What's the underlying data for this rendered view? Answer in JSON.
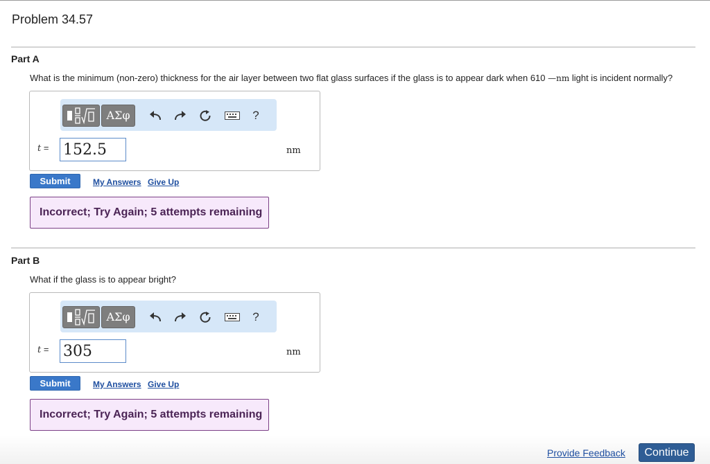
{
  "page_title": "Problem 34.57",
  "colors": {
    "submit_blue": "#3a78c9",
    "feedback_bg": "#f7e9fb",
    "feedback_border": "#7b3f86",
    "toolbar_bg": "#d6e7f8",
    "continue_blue": "#2f5d95"
  },
  "toolbar": {
    "templates_icon": "fraction-sqrt-templates-icon",
    "symbols_label": "ΑΣφ",
    "undo_icon": "undo-arrow-icon",
    "redo_icon": "redo-arrow-icon",
    "reset_icon": "reset-circle-icon",
    "keyboard_icon": "keyboard-icon",
    "help_label": "?"
  },
  "parts": [
    {
      "label": "Part A",
      "question_before": "What is the minimum (non-zero) thickness for the air layer between two flat glass surfaces if the glass is to appear dark when 610 ",
      "question_unit": "—nm",
      "question_after": " light is incident normally?",
      "variable": "t",
      "equals": "=",
      "answer_value": "152.5",
      "unit": "nm",
      "submit_label": "Submit",
      "my_answers_label": "My Answers",
      "give_up_label": "Give Up",
      "feedback": "Incorrect; Try Again; 5 attempts remaining"
    },
    {
      "label": "Part B",
      "question": "What if the glass is to appear bright?",
      "variable": "t",
      "equals": "=",
      "answer_value": "305",
      "unit": "nm",
      "submit_label": "Submit",
      "my_answers_label": "My Answers",
      "give_up_label": "Give Up",
      "feedback": "Incorrect; Try Again; 5 attempts remaining"
    }
  ],
  "footer": {
    "provide_feedback_label": "Provide Feedback",
    "continue_label": "Continue"
  }
}
